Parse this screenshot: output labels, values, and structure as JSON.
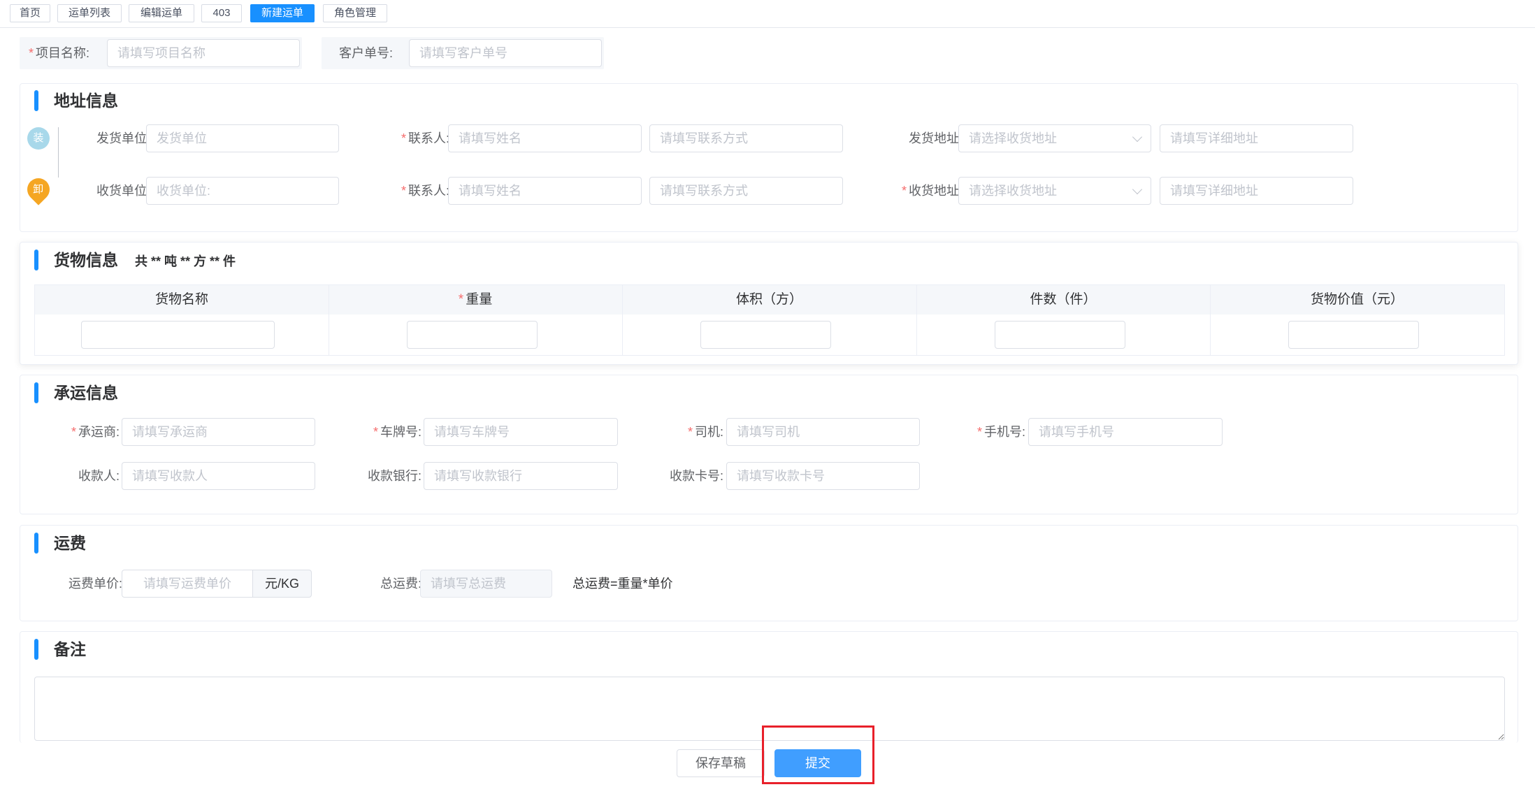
{
  "tabs": [
    {
      "label": "首页",
      "active": false
    },
    {
      "label": "运单列表",
      "active": false
    },
    {
      "label": "编辑运单",
      "active": false
    },
    {
      "label": "403",
      "active": false
    },
    {
      "label": "新建运单",
      "active": true
    },
    {
      "label": "角色管理",
      "active": false
    }
  ],
  "header_fields": {
    "project_label": "项目名称:",
    "project_placeholder": "请填写项目名称",
    "customer_label": "客户单号:",
    "customer_placeholder": "请填写客户单号"
  },
  "address": {
    "title": "地址信息",
    "load_icon": "装",
    "unload_icon": "卸",
    "rows": [
      {
        "unit_label": "发货单位:",
        "unit_placeholder": "发货单位",
        "contact_label": "联系人:",
        "contact_name_placeholder": "请填写姓名",
        "contact_phone_placeholder": "请填写联系方式",
        "addr_label": "发货地址:",
        "addr_select_placeholder": "请选择收货地址",
        "addr_detail_placeholder": "请填写详细地址"
      },
      {
        "unit_label": "收货单位:",
        "unit_placeholder": "收货单位:",
        "contact_label": "联系人:",
        "contact_name_placeholder": "请填写姓名",
        "contact_phone_placeholder": "请填写联系方式",
        "addr_label": "收货地址:",
        "addr_select_placeholder": "请选择收货地址",
        "addr_detail_placeholder": "请填写详细地址"
      }
    ]
  },
  "goods": {
    "title": "货物信息",
    "summary": "共 ** 吨 ** 方 ** 件",
    "columns": [
      "货物名称",
      "重量",
      "体积（方）",
      "件数（件）",
      "货物价值（元）"
    ]
  },
  "carrier": {
    "title": "承运信息",
    "carrier_label": "承运商:",
    "carrier_placeholder": "请填写承运商",
    "plate_label": "车牌号:",
    "plate_placeholder": "请填写车牌号",
    "driver_label": "司机:",
    "driver_placeholder": "请填写司机",
    "phone_label": "手机号:",
    "phone_placeholder": "请填写手机号",
    "payee_label": "收款人:",
    "payee_placeholder": "请填写收款人",
    "bank_label": "收款银行:",
    "bank_placeholder": "请填写收款银行",
    "card_label": "收款卡号:",
    "card_placeholder": "请填写收款卡号"
  },
  "freight": {
    "title": "运费",
    "unit_price_label": "运费单价:",
    "unit_price_placeholder": "请填写运费单价",
    "unit_suffix": "元/KG",
    "total_label": "总运费:",
    "total_placeholder": "请填写总运费",
    "formula": "总运费=重量*单价"
  },
  "remark": {
    "title": "备注"
  },
  "footer": {
    "save_draft": "保存草稿",
    "submit": "提交"
  },
  "colors": {
    "primary": "#409eff",
    "tab_active": "#1890ff",
    "required_star": "#f56c6c",
    "highlight_box": "#e8202a",
    "load_icon": "#a8d8ea",
    "unload_icon": "#f5a623"
  }
}
